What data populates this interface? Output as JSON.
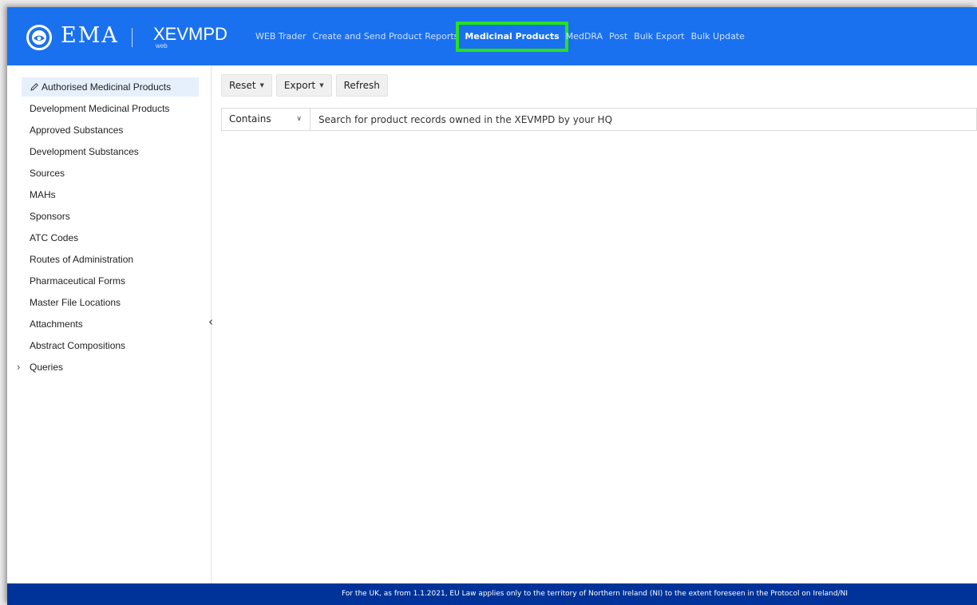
{
  "header": {
    "logo_text": "EMA",
    "app_name": "XEVMPD",
    "app_sub": "web",
    "nav": [
      {
        "label": "WEB Trader"
      },
      {
        "label": "Create and Send Product Reports"
      },
      {
        "label": "Medicinal Products",
        "active": true
      },
      {
        "label": "MedDRA"
      },
      {
        "label": "Post"
      },
      {
        "label": "Bulk Export"
      },
      {
        "label": "Bulk Update"
      }
    ]
  },
  "sidebar": {
    "items": [
      {
        "label": "Authorised Medicinal Products",
        "selected": true,
        "icon": "pencil-icon"
      },
      {
        "label": "Development Medicinal Products"
      },
      {
        "label": "Approved Substances"
      },
      {
        "label": "Development Substances"
      },
      {
        "label": "Sources"
      },
      {
        "label": "MAHs"
      },
      {
        "label": "Sponsors"
      },
      {
        "label": "ATC Codes"
      },
      {
        "label": "Routes of Administration"
      },
      {
        "label": "Pharmaceutical Forms"
      },
      {
        "label": "Master File Locations"
      },
      {
        "label": "Attachments"
      },
      {
        "label": "Abstract Compositions"
      },
      {
        "label": "Queries",
        "expandable": true,
        "icon": "chevron-right-icon"
      }
    ],
    "collapse_icon": "chevron-left-icon"
  },
  "toolbar": {
    "reset_label": "Reset",
    "export_label": "Export",
    "refresh_label": "Refresh"
  },
  "search": {
    "mode": "Contains",
    "placeholder": "Search for product records owned in the XEVMPD by your HQ"
  },
  "footer": {
    "text": "For the UK, as from 1.1.2021, EU Law applies only to the territory of Northern Ireland (NI) to the extent foreseen in the Protocol on Ireland/NI"
  },
  "colors": {
    "header_bg": "#1a71ef",
    "footer_bg": "#003399",
    "active_highlight": "#27e21b",
    "selected_item_bg": "#e6f0fd"
  }
}
